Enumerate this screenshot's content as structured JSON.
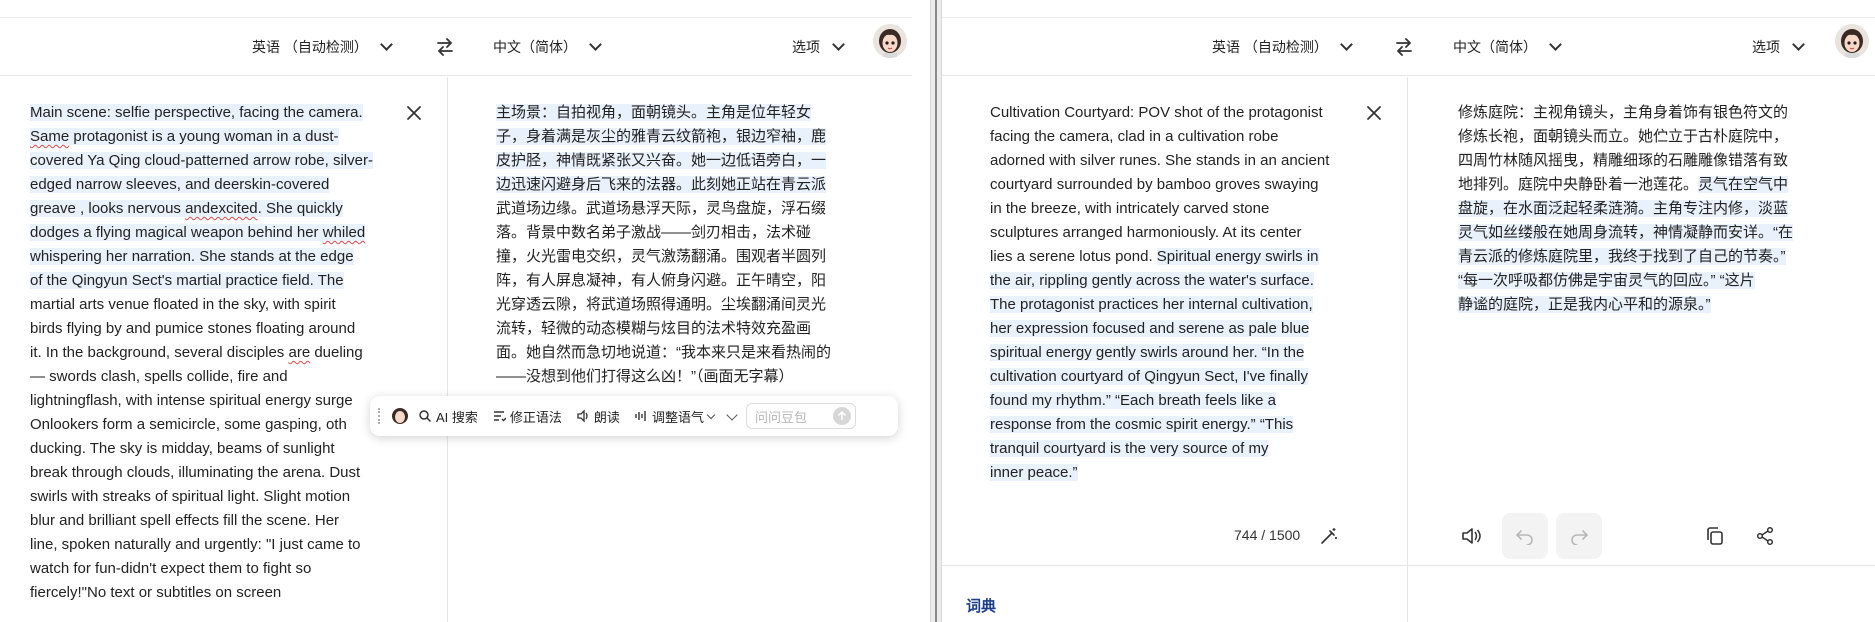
{
  "left": {
    "source_lang": "英语 （自动检测）",
    "target_lang": "中文（简体）",
    "options_label": "选项",
    "source_lines": [
      [
        {
          "t": "Main scene: selfie perspective, facing the camera. ",
          "hl": true
        }
      ],
      [
        {
          "t": "Same",
          "hl": true,
          "sq": true
        },
        {
          "t": " protagonist is a young woman in a dust-",
          "hl": true
        }
      ],
      [
        {
          "t": "covered Ya Qing cloud-patterned arrow robe, silver-",
          "hl": true
        }
      ],
      [
        {
          "t": "edged narrow sleeves, and deerskin-covered",
          "hl": true
        }
      ],
      [
        {
          "t": "greave , looks nervous ",
          "hl": true
        },
        {
          "t": "andexcited",
          "hl": true,
          "sq": true
        },
        {
          "t": ". She quickly",
          "hl": true
        }
      ],
      [
        {
          "t": "dodges a flying magical weapon behind her ",
          "hl": true
        },
        {
          "t": "whiled",
          "hl": true,
          "sq": true
        }
      ],
      [
        {
          "t": "whispering her narration. She stands at the edge",
          "hl": true
        }
      ],
      [
        {
          "t": "of the Qingyun Sect's martial practice field. The",
          "hl": true
        }
      ],
      [
        {
          "t": "martial arts venue floated in the sky, with spirit"
        }
      ],
      [
        {
          "t": "birds flying by and pumice stones floating around"
        }
      ],
      [
        {
          "t": "it. In the background, several disciples "
        },
        {
          "t": "are",
          "sq": true
        },
        {
          "t": " dueling"
        }
      ],
      [
        {
          "t": "— swords clash, spells collide, fire and"
        }
      ],
      [
        {
          "t": "lightningflash, with intense spiritual energy surge"
        }
      ],
      [
        {
          "t": "Onlookers form a semicircle, some gasping, oth"
        }
      ],
      [
        {
          "t": "ducking. The sky is midday, beams of sunlight"
        }
      ],
      [
        {
          "t": "break through clouds, illuminating the arena. Dust"
        }
      ],
      [
        {
          "t": "swirls with streaks of spiritual light. Slight motion"
        }
      ],
      [
        {
          "t": "blur and brilliant spell effects fill the scene. Her"
        }
      ],
      [
        {
          "t": "line, spoken naturally and urgently: \"I just came to"
        }
      ],
      [
        {
          "t": "watch for fun-didn't expect them to fight so"
        }
      ],
      [
        {
          "t": "fiercely!\"No text or subtitles on screen"
        }
      ]
    ],
    "target_lines": [
      [
        {
          "t": "主场景：自拍视角，面朝镜头。主角是位年轻女",
          "hl": true
        }
      ],
      [
        {
          "t": "子，身着满是灰尘的雅青云纹箭袍，银边窄袖，鹿",
          "hl": true
        }
      ],
      [
        {
          "t": "皮护胫，神情既紧张又兴奋。她一边低语旁白，一",
          "hl": true
        }
      ],
      [
        {
          "t": "边迅速闪避身后飞来的法器。此刻她正站在青云派",
          "hl": true
        }
      ],
      [
        {
          "t": "武道场边缘。武道场悬浮天际，灵鸟盘旋，浮石缀"
        }
      ],
      [
        {
          "t": "落。背景中数名弟子激战——剑刃相击，法术碰"
        }
      ],
      [
        {
          "t": "撞，火光雷电交织，灵气激荡翻涌。围观者半圆列"
        }
      ],
      [
        {
          "t": "阵，有人屏息凝神，有人俯身闪避。正午晴空，阳"
        }
      ],
      [
        {
          "t": "光穿透云隙，将武道场照得通明。尘埃翻涌间灵光"
        }
      ],
      [
        {
          "t": "流转，轻微的动态模糊与炫目的法术特效充盈画"
        }
      ],
      [
        {
          "t": "面。她自然而急切地说道：“我本来只是来看热闹的"
        }
      ],
      [
        {
          "t": "——没想到他们打得这么凶！”（画面无字幕）"
        }
      ]
    ]
  },
  "float_toolbar": {
    "ai_search": "AI 搜索",
    "fix_grammar": "修正语法",
    "read_aloud": "朗读",
    "adjust_tone": "调整语气",
    "ask_placeholder": "问问豆包"
  },
  "right": {
    "source_lang": "英语 （自动检测）",
    "target_lang": "中文（简体）",
    "options_label": "选项",
    "source_lines": [
      [
        {
          "t": "Cultivation Courtyard: POV shot of the protagonist"
        }
      ],
      [
        {
          "t": "facing the camera, clad in a cultivation robe"
        }
      ],
      [
        {
          "t": "adorned with silver runes. She stands in an ancient"
        }
      ],
      [
        {
          "t": "courtyard surrounded by bamboo groves swaying"
        }
      ],
      [
        {
          "t": "in the breeze, with intricately carved stone"
        }
      ],
      [
        {
          "t": "sculptures arranged harmoniously. At its center"
        }
      ],
      [
        {
          "t": "lies a serene lotus pond. ",
          "hl": false
        },
        {
          "t": "Spiritual energy swirls in",
          "hl": true
        }
      ],
      [
        {
          "t": "the air, rippling gently across the water's surface.",
          "hl": true
        }
      ],
      [
        {
          "t": "The protagonist practices her internal cultivation,",
          "hl": true
        }
      ],
      [
        {
          "t": "her expression focused and serene as pale blue",
          "hl": true
        }
      ],
      [
        {
          "t": "spiritual energy gently swirls around her. “In the",
          "hl": true
        }
      ],
      [
        {
          "t": "cultivation courtyard of Qingyun Sect, I've finally",
          "hl": true
        }
      ],
      [
        {
          "t": "found my rhythm.” “Each breath feels like a",
          "hl": true
        }
      ],
      [
        {
          "t": "response from the cosmic spirit energy.” “This",
          "hl": true
        }
      ],
      [
        {
          "t": "tranquil courtyard is the very source of my",
          "hl": true
        }
      ],
      [
        {
          "t": "inner peace.”",
          "hl": true
        }
      ]
    ],
    "target_lines": [
      [
        {
          "t": "修炼庭院：主视角镜头，主角身着饰有银色符文的"
        }
      ],
      [
        {
          "t": "修炼长袍，面朝镜头而立。她伫立于古朴庭院中，"
        }
      ],
      [
        {
          "t": "四周竹林随风摇曳，精雕细琢的石雕雕像错落有致"
        }
      ],
      [
        {
          "t": "地排列。庭院中央静卧着一池莲花。"
        },
        {
          "t": "灵气在空气中",
          "hl": true
        }
      ],
      [
        {
          "t": "盘旋，在水面泛起轻柔涟漪。主角专注内修，淡蓝",
          "hl": true
        }
      ],
      [
        {
          "t": "灵气如丝缕般在她周身流转，神情凝静而安详。“在",
          "hl": true
        }
      ],
      [
        {
          "t": "青云派的修炼庭院里，我终于找到了自己的节奏。”",
          "hl": true
        }
      ],
      [
        {
          "t": "“每一次呼吸都仿佛是宇宙灵气的回应。” “这片",
          "hl": true
        }
      ],
      [
        {
          "t": "静谧的庭院，正是我内心平和的源泉。”",
          "hl": true
        }
      ]
    ],
    "char_count": "744 / 1500",
    "dict_label": "词典"
  }
}
